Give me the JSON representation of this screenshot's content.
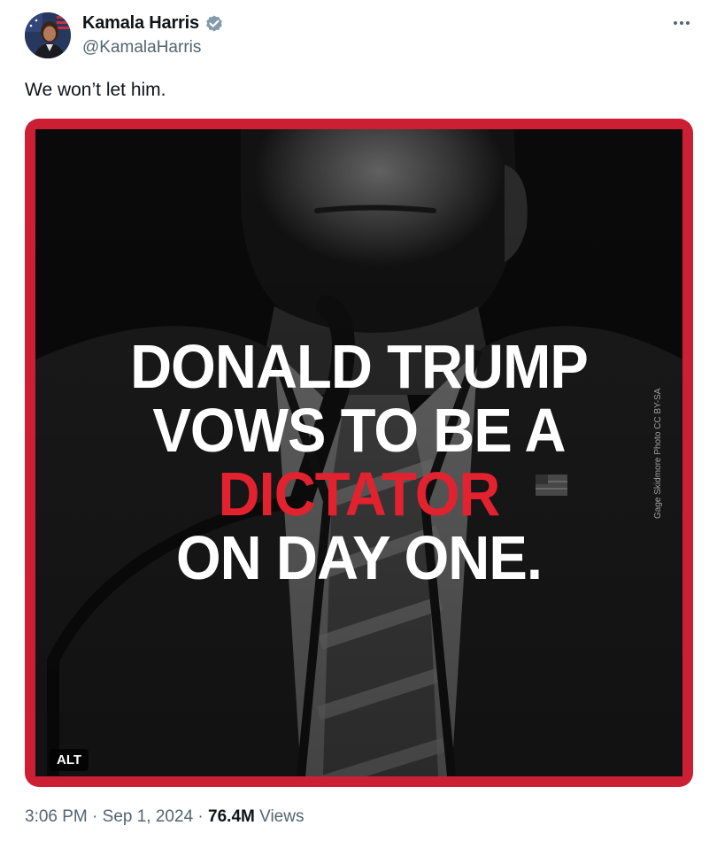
{
  "author": {
    "name": "Kamala Harris",
    "handle": "@KamalaHarris",
    "verified_icon": "verified-badge-icon"
  },
  "more_icon": "more-options-icon",
  "tweet": {
    "text": "We won’t let him."
  },
  "media": {
    "headline_line_1": "DONALD TRUMP",
    "headline_line_2": "VOWS TO BE A",
    "headline_line_3": "DICTATOR",
    "headline_line_4": "ON DAY ONE.",
    "photo_credit": "Gage Skidmore Photo CC BY-SA",
    "alt_label": "ALT",
    "border_color": "#cc1f34",
    "highlight_color": "#e3222f"
  },
  "meta": {
    "time": "3:06 PM",
    "separator": "·",
    "date": "Sep 1, 2024",
    "views_count": "76.4M",
    "views_label": "Views"
  }
}
